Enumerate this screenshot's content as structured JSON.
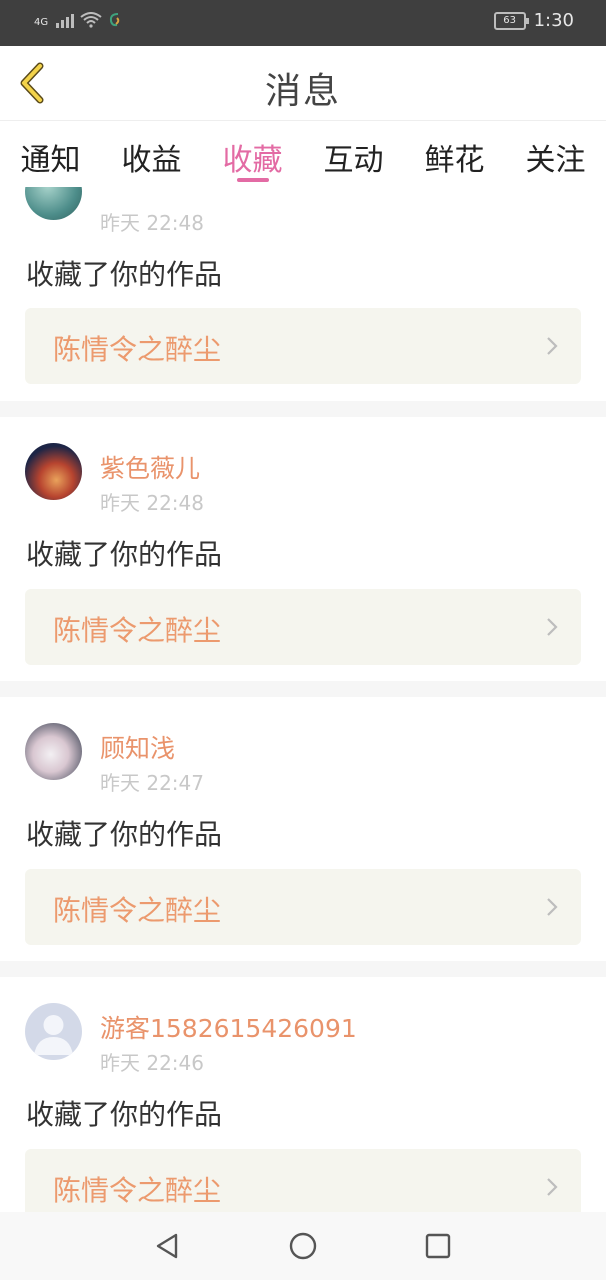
{
  "status_bar": {
    "network": "4G",
    "battery": "63",
    "time": "1:30"
  },
  "header": {
    "title": "消息",
    "back_icon": "chevron-left-icon",
    "accent": "#e36ba4"
  },
  "tabs": [
    {
      "label": "通知",
      "active": false
    },
    {
      "label": "收益",
      "active": false
    },
    {
      "label": "收藏",
      "active": true
    },
    {
      "label": "互动",
      "active": false
    },
    {
      "label": "鲜花",
      "active": false
    },
    {
      "label": "关注",
      "active": false
    }
  ],
  "items": [
    {
      "user": "",
      "date": "昨天 22:48",
      "action": "收藏了你的作品",
      "work": "陈情令之醉尘"
    },
    {
      "user": "紫色薇儿",
      "date": "昨天 22:48",
      "action": "收藏了你的作品",
      "work": "陈情令之醉尘"
    },
    {
      "user": "顾知浅",
      "date": "昨天 22:47",
      "action": "收藏了你的作品",
      "work": "陈情令之醉尘"
    },
    {
      "user": "游客1582615426091",
      "date": "昨天 22:46",
      "action": "收藏了你的作品",
      "work": "陈情令之醉尘"
    }
  ],
  "colors": {
    "username": "#e9936b",
    "work_title": "#ec9a6e",
    "work_bg": "#f5f5ee",
    "timestamp": "#c8c8c8"
  },
  "nav": {
    "back_icon": "triangle-back-icon",
    "home_icon": "circle-home-icon",
    "recents_icon": "square-recents-icon"
  }
}
